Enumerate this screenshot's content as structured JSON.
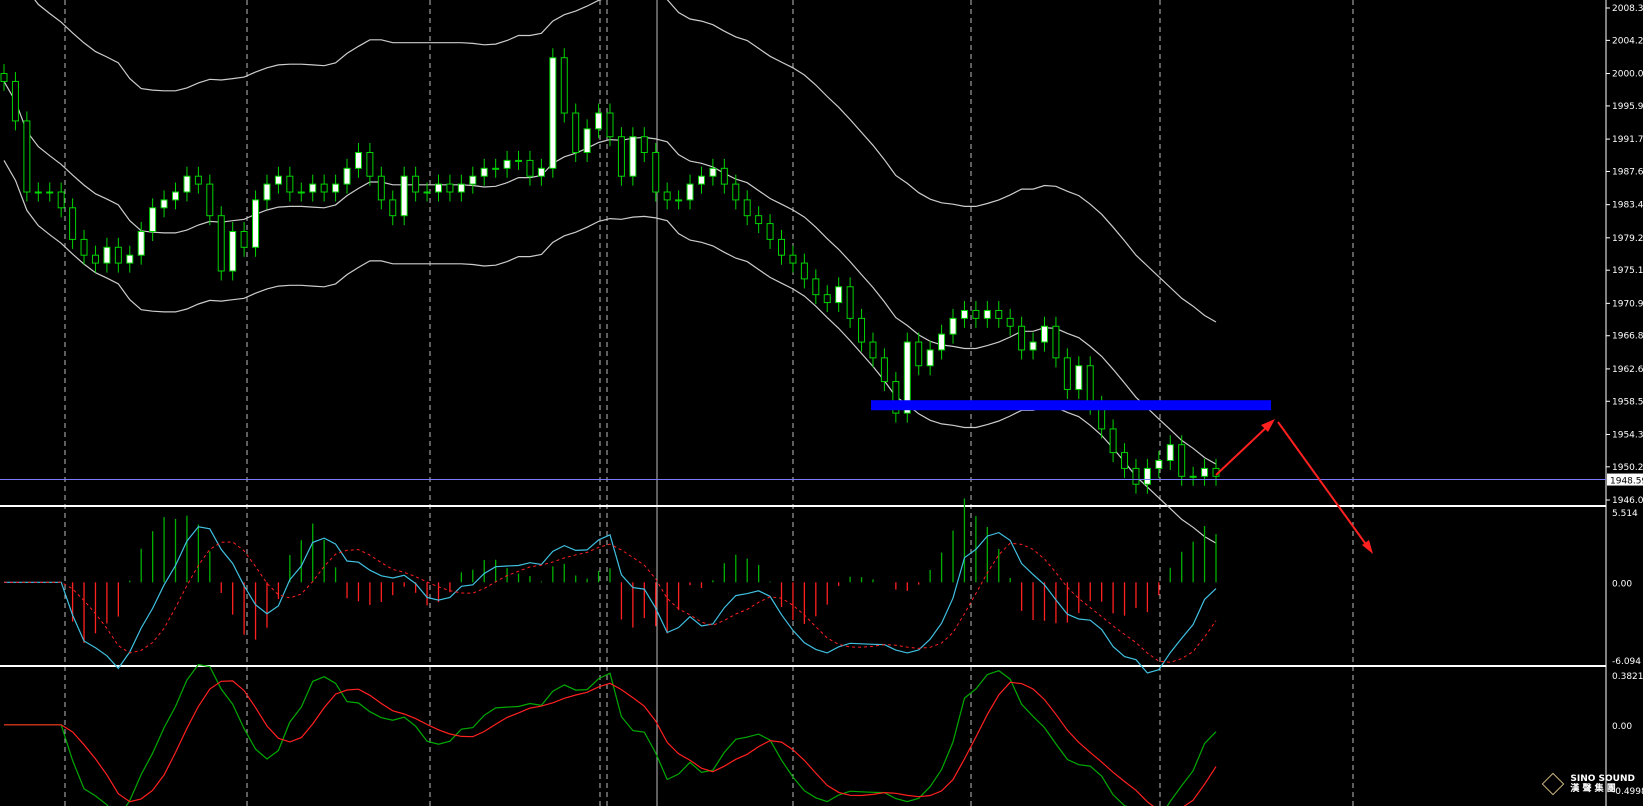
{
  "chart_data": {
    "type": "candlestick",
    "price_panel": {
      "y_ticks": [
        "2008.30",
        "2004.20",
        "2000.00",
        "1995.90",
        "1991.70",
        "1987.60",
        "1983.40",
        "1979.20",
        "1975.10",
        "1970.90",
        "1966.80",
        "1962.60",
        "1958.50",
        "1954.30",
        "1950.20",
        "1946.00"
      ],
      "ylim": [
        1946.0,
        2008.3
      ],
      "current_price": "1948.59",
      "support_zone": 1958.0,
      "candles_close_approx": [
        1999,
        1994,
        1985,
        1985,
        1985,
        1983,
        1979,
        1977,
        1976,
        1978,
        1976,
        1977,
        1980,
        1983,
        1984,
        1985,
        1987,
        1986,
        1982,
        1975,
        1980,
        1978,
        1984,
        1986,
        1987,
        1985,
        1985,
        1986,
        1985,
        1986,
        1988,
        1990,
        1987,
        1984,
        1982,
        1987,
        1985,
        1985,
        1986,
        1985,
        1986,
        1987,
        1988,
        1988,
        1989,
        1989,
        1987,
        1988,
        2002,
        1995,
        1990,
        1993,
        1995,
        1992,
        1987,
        1992,
        1990,
        1985,
        1984,
        1984,
        1986,
        1987,
        1988,
        1986,
        1984,
        1982,
        1981,
        1979,
        1977,
        1976,
        1974,
        1972,
        1971,
        1973,
        1969,
        1966,
        1964,
        1961,
        1957,
        1966,
        1963,
        1965,
        1967,
        1969,
        1970,
        1969,
        1970,
        1969,
        1968,
        1965,
        1966,
        1968,
        1964,
        1960,
        1963,
        1958,
        1955,
        1952,
        1950,
        1948,
        1950,
        1951,
        1953,
        1949,
        1949,
        1950,
        1949
      ]
    },
    "macd_panel": {
      "y_ticks": [
        "5.514",
        "0.00",
        "-6.094"
      ],
      "ylim": [
        -6.094,
        5.514
      ]
    },
    "oscillator_panel": {
      "y_ticks": [
        "0.3821",
        "0.00",
        "-0.4998"
      ],
      "ylim": [
        -0.4998,
        0.3821
      ]
    },
    "colors": {
      "background": "#000000",
      "bull_body": "#ffffff",
      "candle_green": "#00d400",
      "support_zone": "#0000ff",
      "arrow": "#ff2020",
      "macd_line": "#40c0e0",
      "signal_dotted": "#ff2020",
      "osc_green": "#00aa00",
      "osc_red": "#ff2020",
      "bands": "#cccccc"
    }
  },
  "logo": {
    "name": "SINO SOUND",
    "sub": "漢 聲 集 團"
  }
}
